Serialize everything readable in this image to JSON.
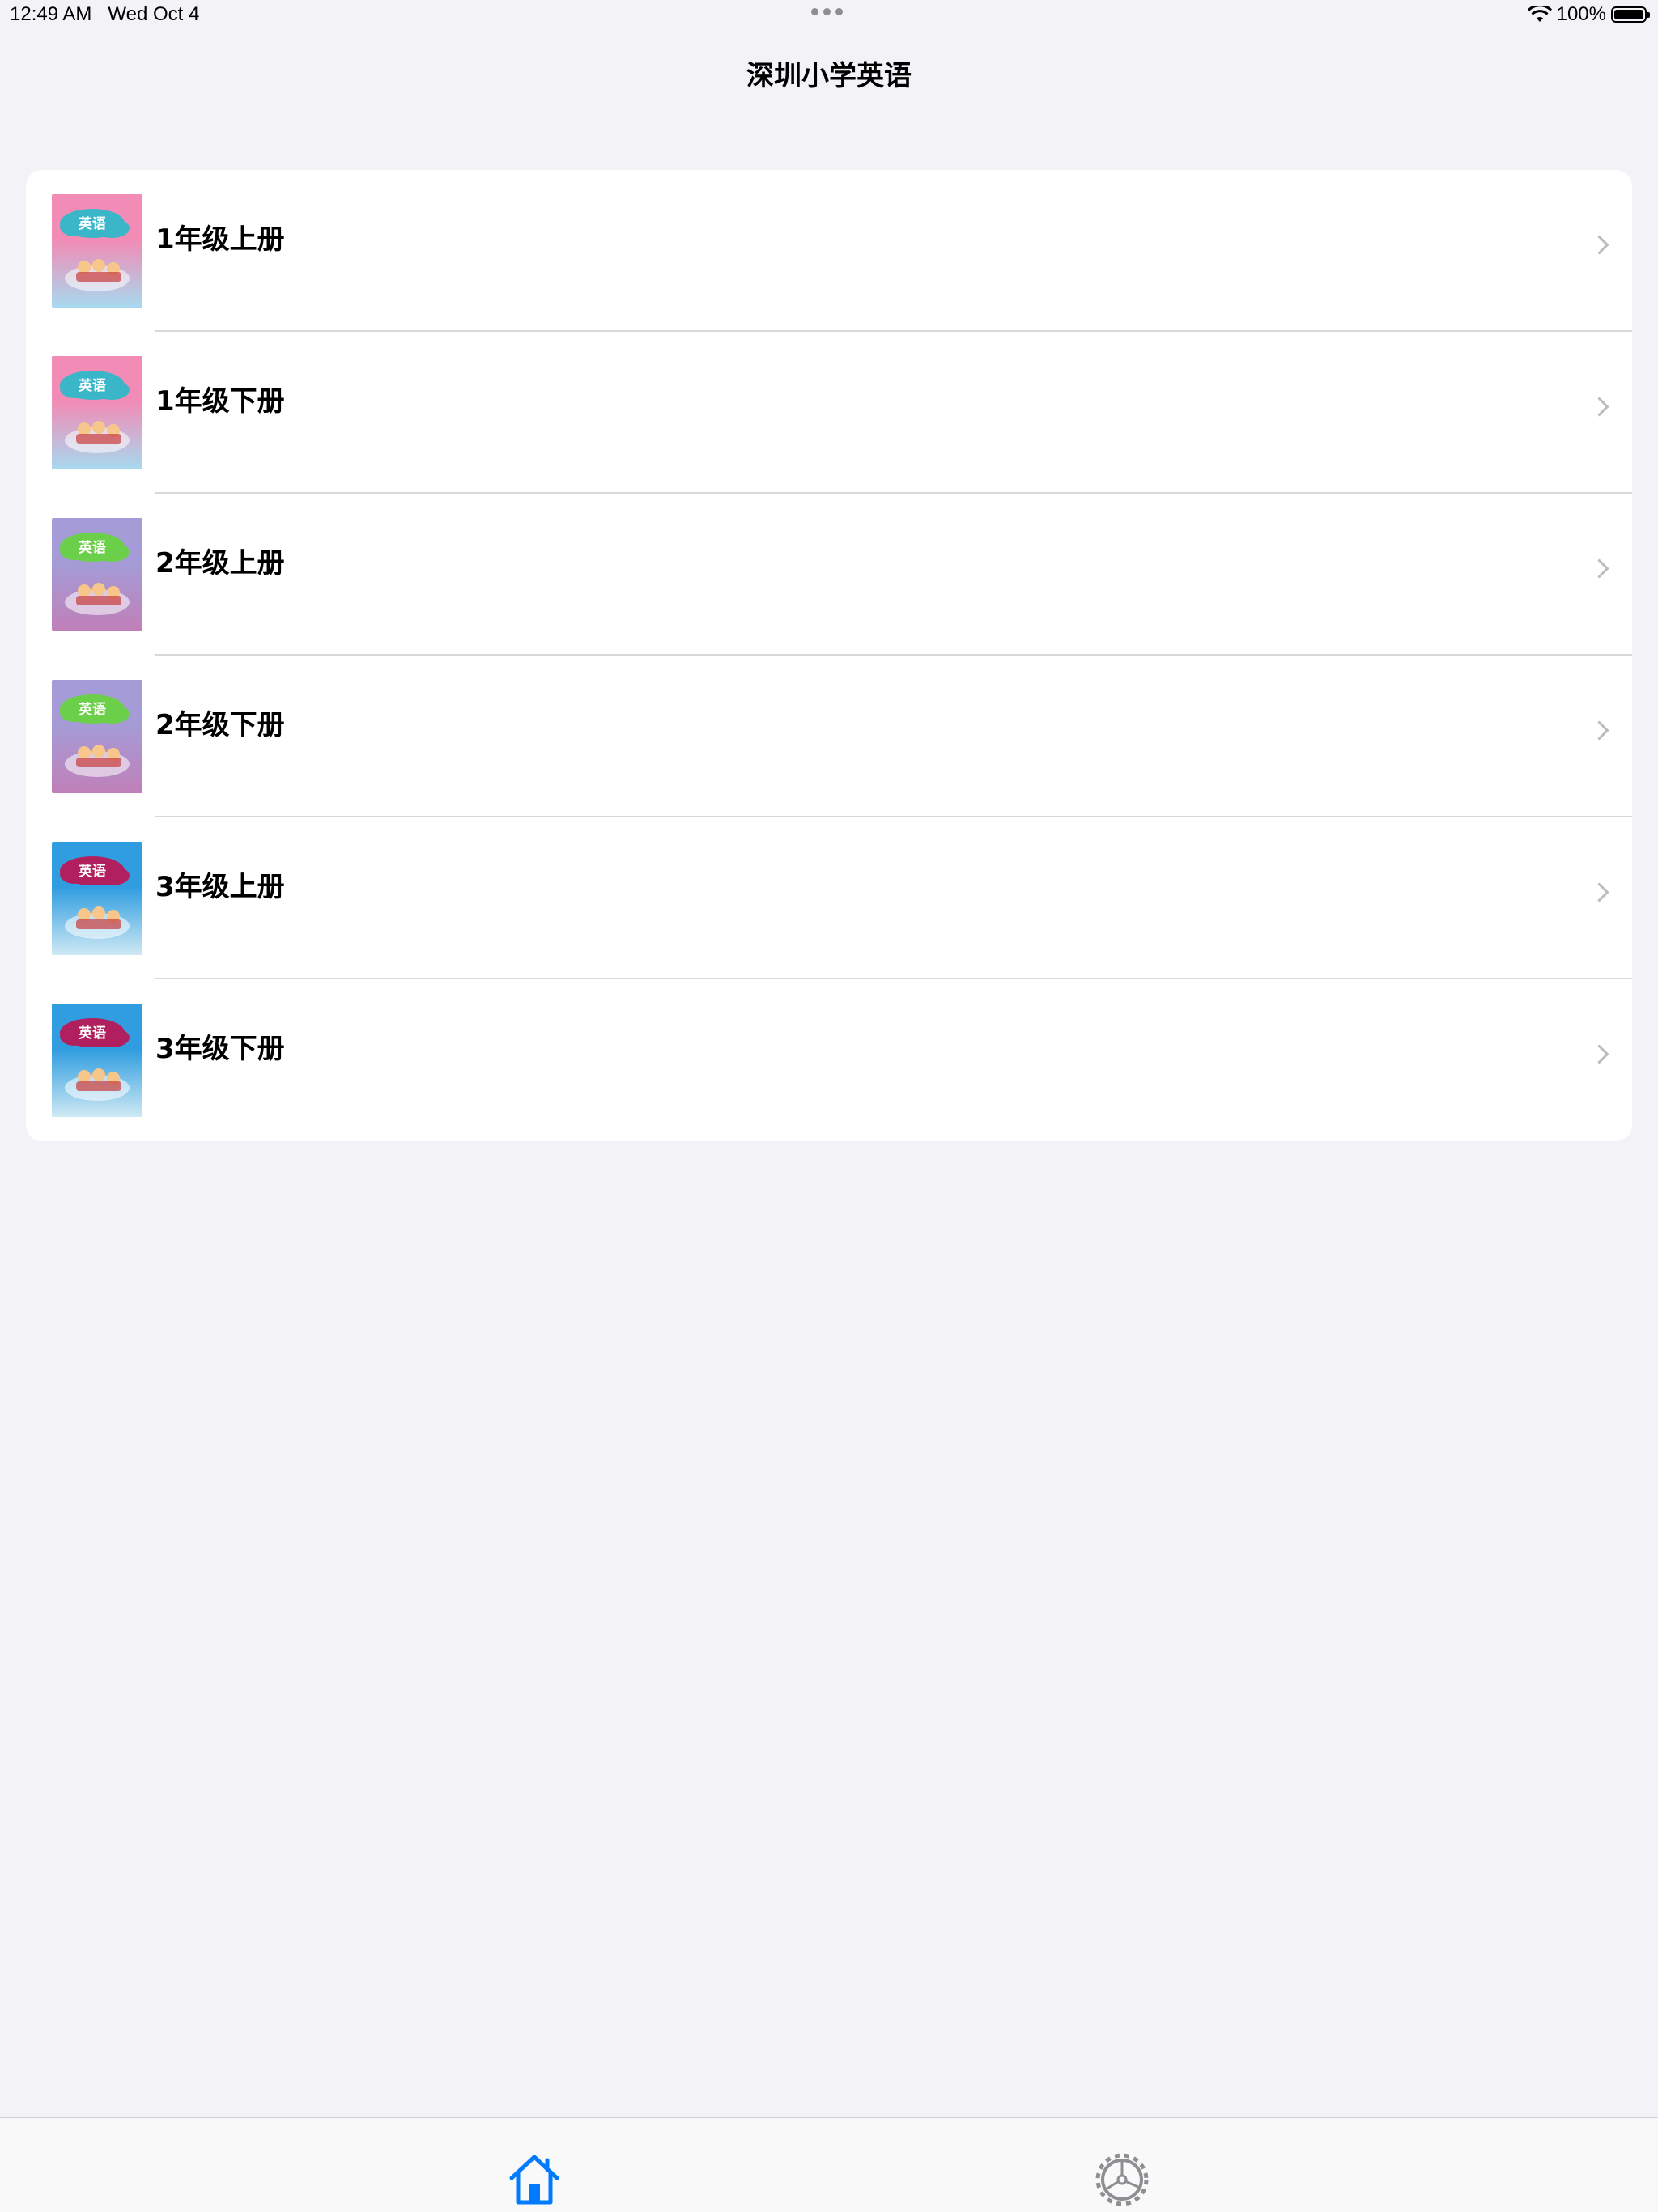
{
  "status_bar": {
    "time": "12:49 AM",
    "date": "Wed Oct 4",
    "battery": "100%"
  },
  "nav": {
    "title": "深圳小学英语"
  },
  "thumb_text": "英语",
  "grades": [
    {
      "label": "1年级上册",
      "cover_top": "#f28bb5",
      "cover_bottom": "#a7d9ef",
      "cloud": "#3bb6c9"
    },
    {
      "label": "1年级下册",
      "cover_top": "#f28bb5",
      "cover_bottom": "#a7d9ef",
      "cloud": "#3bb6c9"
    },
    {
      "label": "2年级上册",
      "cover_top": "#a59bd6",
      "cover_bottom": "#c07fb8",
      "cloud": "#6ccf4a"
    },
    {
      "label": "2年级下册",
      "cover_top": "#a59bd6",
      "cover_bottom": "#c07fb8",
      "cloud": "#6ccf4a"
    },
    {
      "label": "3年级上册",
      "cover_top": "#2f9de0",
      "cover_bottom": "#cfe9f4",
      "cloud": "#b0205f"
    },
    {
      "label": "3年级下册",
      "cover_top": "#2f9de0",
      "cover_bottom": "#cfe9f4",
      "cloud": "#b0205f"
    }
  ],
  "tabs": [
    {
      "icon": "home-icon",
      "active": true,
      "color": "#007aff"
    },
    {
      "icon": "gear-icon",
      "active": false,
      "color": "#8e8e93"
    }
  ]
}
